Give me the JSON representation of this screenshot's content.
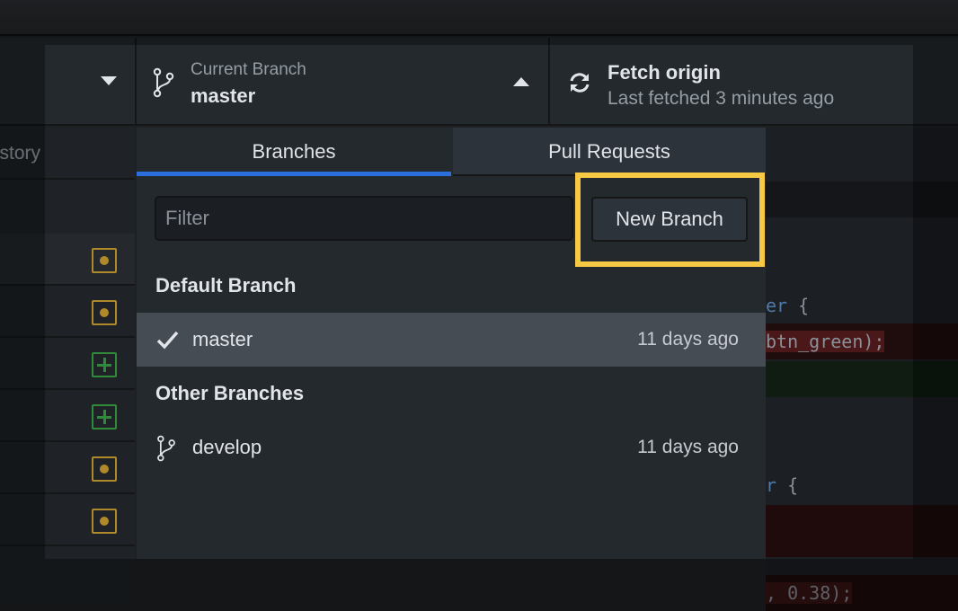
{
  "toolbar": {
    "current_branch_label": "Current Branch",
    "current_branch": "master",
    "fetch_title": "Fetch origin",
    "fetch_subtitle": "Last fetched 3 minutes ago"
  },
  "sidebar": {
    "history_tab": "History",
    "visible_history_text": "story",
    "files": [
      {
        "status": "modified"
      },
      {
        "status": "modified"
      },
      {
        "status": "added"
      },
      {
        "status": "added"
      },
      {
        "status": "modified"
      },
      {
        "status": "modified"
      }
    ]
  },
  "branch_dropdown": {
    "tabs": [
      "Branches",
      "Pull Requests"
    ],
    "active_tab": "Branches",
    "filter_placeholder": "Filter",
    "filter_value": "",
    "new_branch_label": "New Branch",
    "default_header": "Default Branch",
    "other_header": "Other Branches",
    "default_branches": [
      {
        "name": "master",
        "time": "11 days ago",
        "selected": true
      }
    ],
    "other_branches": [
      {
        "name": "develop",
        "time": "11 days ago"
      }
    ]
  },
  "diff": {
    "lines": [
      "er {",
      "btn_green);",
      "r {",
      ", 0.38);"
    ]
  },
  "colors": {
    "highlight": "#f7c844",
    "accent": "#2a6fdb",
    "modified": "#b08a2a",
    "added": "#2f8a3a"
  }
}
